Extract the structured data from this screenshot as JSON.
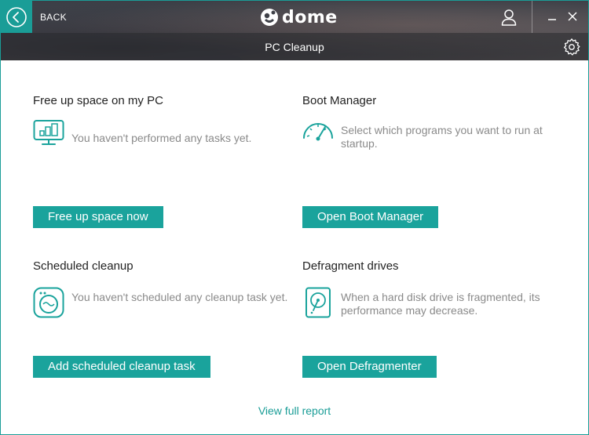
{
  "header": {
    "back_label": "BACK",
    "logo_text": "dome",
    "page_title": "PC Cleanup"
  },
  "colors": {
    "accent": "#1aa39c",
    "text_muted": "#8a8a8a",
    "text_dark": "#222222"
  },
  "icons": {
    "back": "chevron-left-circle-icon",
    "logo": "panda-icon",
    "user": "user-icon",
    "minimize": "minimize-icon",
    "close": "close-icon",
    "settings": "gear-icon"
  },
  "sections": {
    "free_up": {
      "title": "Free up space on my PC",
      "description": "You haven't performed any tasks yet.",
      "button": "Free up space now",
      "icon": "monitor-chart-icon"
    },
    "boot": {
      "title": "Boot Manager",
      "description": "Select which programs you want to run at startup.",
      "button": "Open Boot Manager",
      "icon": "speedometer-icon"
    },
    "scheduled": {
      "title": "Scheduled cleanup",
      "description": "You haven't scheduled any cleanup task yet.",
      "button": "Add scheduled cleanup task",
      "icon": "washing-machine-icon"
    },
    "defrag": {
      "title": "Defragment drives",
      "description": "When a hard disk drive is fragmented, its performance may decrease.",
      "button": "Open Defragmenter",
      "icon": "hard-disk-icon"
    }
  },
  "footer": {
    "report_link": "View full report"
  }
}
